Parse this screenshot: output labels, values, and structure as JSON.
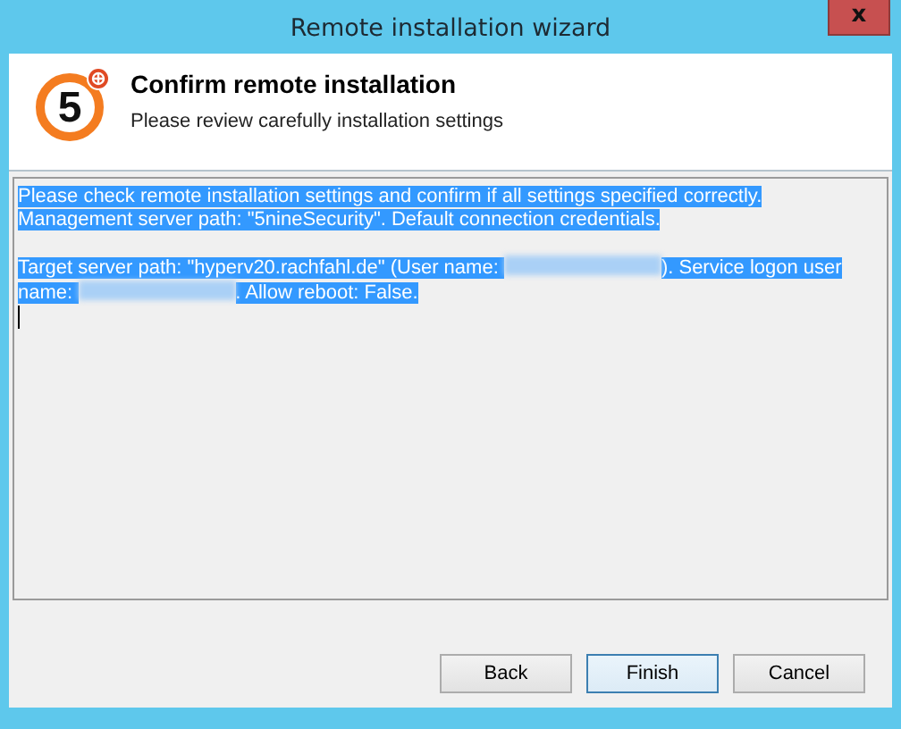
{
  "window": {
    "title": "Remote installation wizard",
    "close": "x"
  },
  "header": {
    "logo_text": "5",
    "title": "Confirm remote installation",
    "subtitle": "Please review carefully installation settings"
  },
  "details": {
    "selected": true,
    "cursor": true,
    "paragraphs": [
      [
        {
          "kind": "text",
          "text": "Please check remote installation settings and confirm if all settings specified correctly."
        },
        {
          "kind": "break"
        },
        {
          "kind": "text",
          "text": "Management server path: \"5nineSecurity\". Default connection credentials."
        }
      ],
      [
        {
          "kind": "text",
          "text": "Target server path: \"hyperv20.rachfahl.de\" (User name: "
        },
        {
          "kind": "redacted"
        },
        {
          "kind": "text",
          "text": "). Service logon user name: "
        },
        {
          "kind": "redacted"
        },
        {
          "kind": "text",
          "text": ". Allow reboot: False."
        }
      ]
    ]
  },
  "buttons": [
    {
      "label": "Back",
      "default": false
    },
    {
      "label": "Finish",
      "default": true
    },
    {
      "label": "Cancel",
      "default": false
    }
  ]
}
